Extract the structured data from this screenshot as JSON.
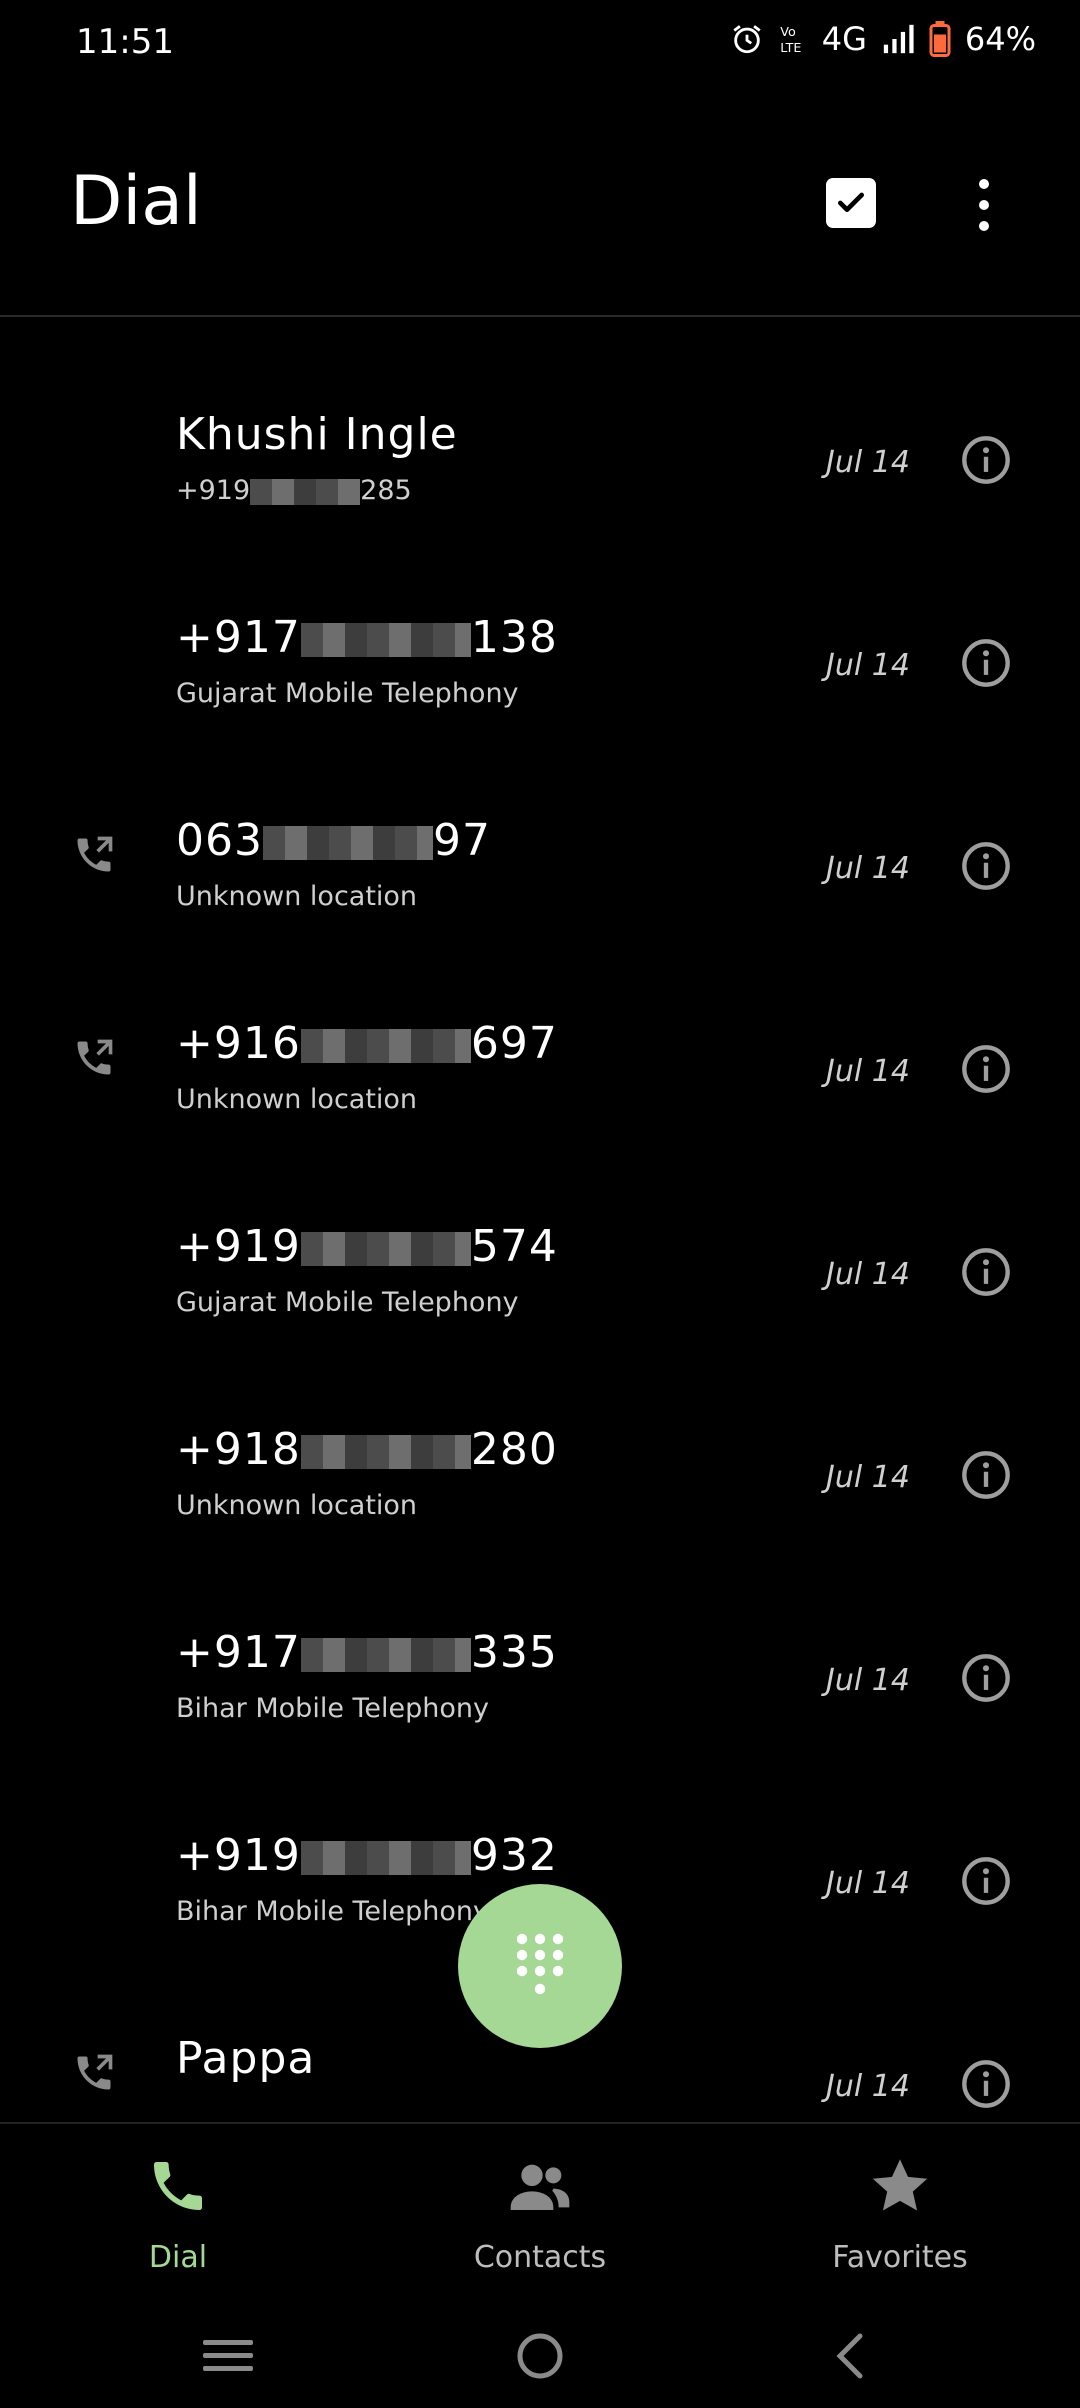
{
  "status_bar": {
    "time": "11:51",
    "network": "4G",
    "battery": "64%"
  },
  "header": {
    "title": "Dial"
  },
  "calls": [
    {
      "name": "Khushi Ingle",
      "sub_prefix": "+919",
      "sub_suffix": "285",
      "date": "Jul 14",
      "outgoing": false,
      "masked_name": false
    },
    {
      "name_prefix": "+917",
      "name_suffix": "138",
      "sub": "Gujarat Mobile Telephony",
      "date": "Jul 14",
      "outgoing": false,
      "masked_name": true
    },
    {
      "name_prefix": "063",
      "name_suffix": "97",
      "sub": "Unknown location",
      "date": "Jul 14",
      "outgoing": true,
      "masked_name": true
    },
    {
      "name_prefix": "+916",
      "name_suffix": "697",
      "sub": "Unknown location",
      "date": "Jul 14",
      "outgoing": true,
      "masked_name": true
    },
    {
      "name_prefix": "+919",
      "name_suffix": "574",
      "sub": "Gujarat Mobile Telephony",
      "date": "Jul 14",
      "outgoing": false,
      "masked_name": true
    },
    {
      "name_prefix": "+918",
      "name_suffix": "280",
      "sub": "Unknown location",
      "date": "Jul 14",
      "outgoing": false,
      "masked_name": true
    },
    {
      "name_prefix": "+917",
      "name_suffix": "335",
      "sub": "Bihar Mobile Telephony",
      "date": "Jul 14",
      "outgoing": false,
      "masked_name": true
    },
    {
      "name_prefix": "+919",
      "name_suffix": "932",
      "sub": "Bihar Mobile Telephony",
      "date": "Jul 14",
      "outgoing": false,
      "masked_name": true
    },
    {
      "name": "Pappa",
      "sub": "",
      "date": "Jul 14",
      "outgoing": true,
      "masked_name": false
    }
  ],
  "bottom_nav": [
    {
      "label": "Dial",
      "icon": "phone-icon",
      "active": true
    },
    {
      "label": "Contacts",
      "icon": "contacts-icon",
      "active": false
    },
    {
      "label": "Favorites",
      "icon": "star-icon",
      "active": false
    }
  ],
  "colors": {
    "accent": "#a5d894",
    "background": "#000000",
    "secondary_text": "#cfcfcf"
  }
}
